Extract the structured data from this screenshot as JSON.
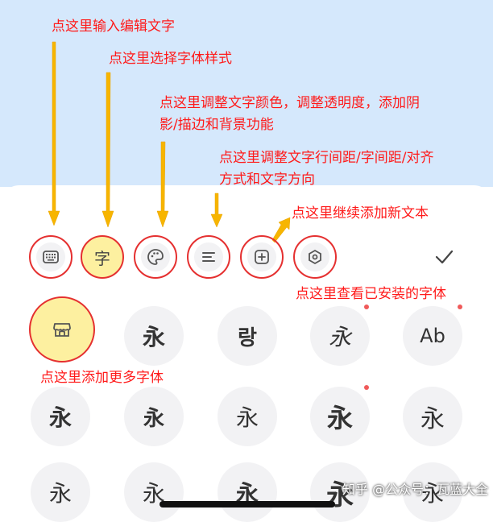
{
  "annotations": {
    "edit_text": "点这里输入编辑文字",
    "font_style": "点这里选择字体样式",
    "color_line1": "点这里调整文字颜色，调整透明度，添加阴",
    "color_line2": "影/描边和背景功能",
    "spacing_line1": "点这里调整文字行间距/字间距/对齐",
    "spacing_line2": "方式和文字方向",
    "add_text": "点这里继续添加新文本",
    "installed_fonts": "点这里查看已安装的字体",
    "more_fonts": "点这里添加更多字体"
  },
  "toolbar": {
    "tools": [
      {
        "name": "keyboard",
        "icon": "keyboard-icon"
      },
      {
        "name": "font",
        "icon": "font-style-icon",
        "glyph": "字"
      },
      {
        "name": "palette",
        "icon": "palette-icon"
      },
      {
        "name": "align",
        "icon": "align-icon"
      },
      {
        "name": "add-text",
        "icon": "add-icon"
      },
      {
        "name": "installed",
        "icon": "hexagon-icon"
      }
    ],
    "confirm_icon": "check-icon"
  },
  "font_grid": {
    "store_icon": "store-icon",
    "row1": [
      "永",
      "랑",
      "永",
      "Ab"
    ],
    "row2": [
      "永",
      "永",
      "永",
      "永",
      "永"
    ],
    "row3": [
      "永",
      "永",
      "永",
      "永",
      "永"
    ]
  },
  "watermark": "知乎 @公众号：瓦蓝大全",
  "colors": {
    "annotation": "#ff1a1a",
    "arrow": "#f7b500",
    "highlight": "#fdf0a0",
    "top_bg": "#d5e8fc"
  }
}
